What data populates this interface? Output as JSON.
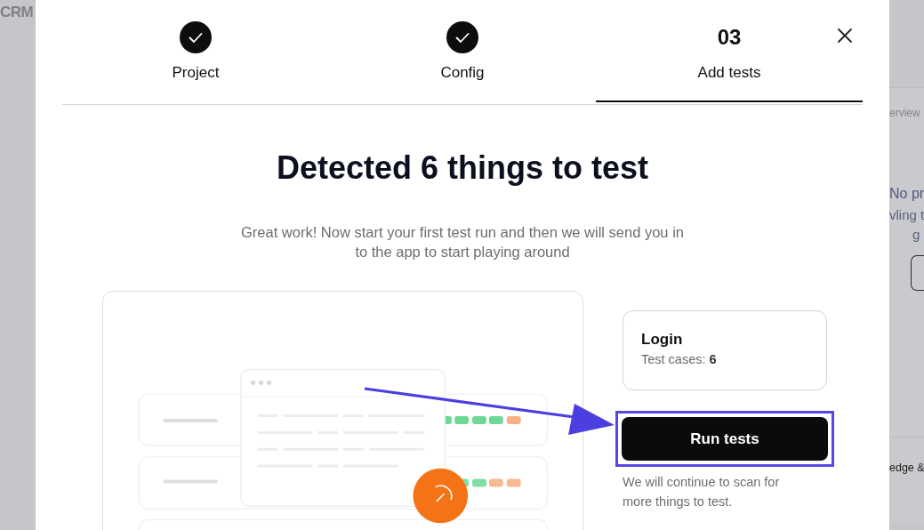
{
  "background": {
    "app_name": "CRM",
    "tab_label": "erview",
    "empty_title": "No pr",
    "empty_text_1": "vling t",
    "empty_text_2": "g",
    "footer_text": "edge &"
  },
  "steps": [
    {
      "label": "Project",
      "completed": true,
      "selected": false
    },
    {
      "label": "Config",
      "completed": true,
      "selected": false
    },
    {
      "label": "Add tests",
      "number": "03",
      "completed": false,
      "selected": true
    }
  ],
  "heading": "Detected 6 things to test",
  "description": "Great work! Now start your first test run and then we will send you in to the app to start playing around",
  "test_card": {
    "name": "Login",
    "cases": "Test cases: **6**"
  },
  "run_button": {
    "label": "Run tests",
    "highlighted": true
  },
  "note": "We will continue to scan for more things to test."
}
